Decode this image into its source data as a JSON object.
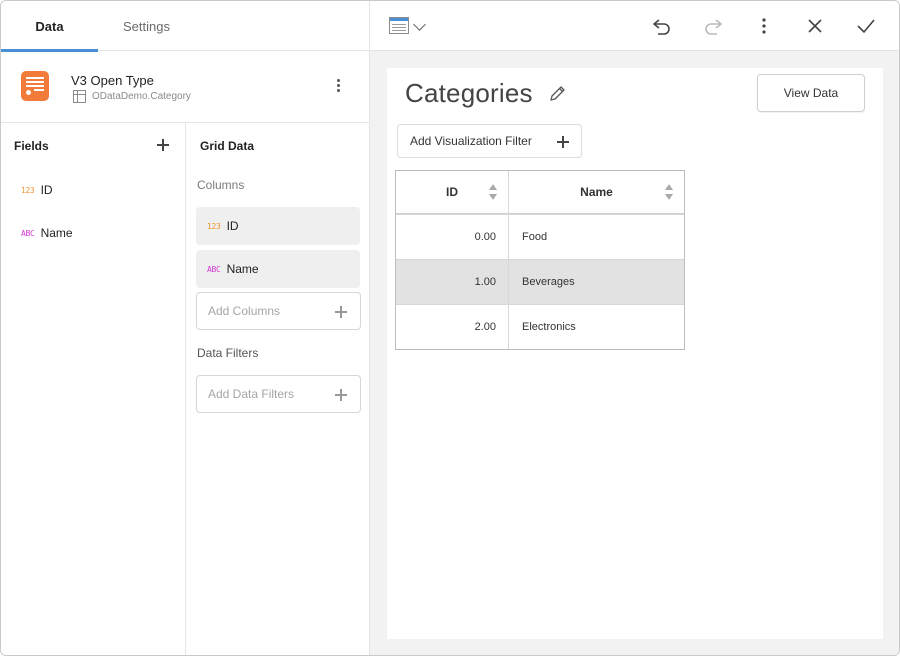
{
  "tabs": [
    {
      "label": "Data",
      "active": true
    },
    {
      "label": "Settings",
      "active": false
    }
  ],
  "datasource": {
    "title": "V3 Open Type",
    "subtitle": "ODataDemo.Category",
    "icon": "spreadsheet-icon",
    "icon_color": "#f27b3a"
  },
  "fields": {
    "title": "Fields",
    "items": [
      {
        "type_badge": "123",
        "label": "ID",
        "kind": "number"
      },
      {
        "type_badge": "ABC",
        "label": "Name",
        "kind": "string"
      }
    ]
  },
  "grid_data": {
    "title": "Grid Data",
    "columns_label": "Columns",
    "columns": [
      {
        "type_badge": "123",
        "label": "ID"
      },
      {
        "type_badge": "ABC",
        "label": "Name"
      }
    ],
    "add_columns_placeholder": "Add Columns",
    "data_filters_label": "Data Filters",
    "add_data_filters_placeholder": "Add Data Filters"
  },
  "toolbar": {
    "visualization_icon": "grid-icon",
    "buttons": [
      "undo-icon",
      "redo-icon",
      "more-vertical-icon",
      "close-icon",
      "check-icon"
    ]
  },
  "visualization": {
    "title": "Categories",
    "view_data_label": "View Data",
    "add_filter_label": "Add Visualization Filter",
    "table": {
      "headers": [
        "ID",
        "Name"
      ],
      "rows": [
        [
          "0.00",
          "Food"
        ],
        [
          "1.00",
          "Beverages"
        ],
        [
          "2.00",
          "Electronics"
        ]
      ],
      "selected_row": 1
    }
  },
  "colors": {
    "accent": "#4a8fd6",
    "number_badge": "#f0932b",
    "string_badge": "#d63ad6",
    "selected_row": "#e2e2e2"
  }
}
